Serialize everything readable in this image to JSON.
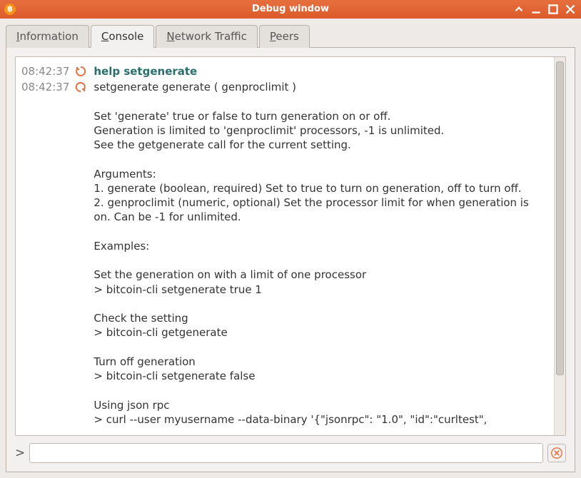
{
  "window": {
    "title": "Debug window",
    "app_icon_letter": "฿"
  },
  "tabs": [
    {
      "label_pre": "",
      "label_u": "I",
      "label_post": "nformation",
      "active": false
    },
    {
      "label_pre": "",
      "label_u": "C",
      "label_post": "onsole",
      "active": true
    },
    {
      "label_pre": "",
      "label_u": "N",
      "label_post": "etwork Traffic",
      "active": false
    },
    {
      "label_pre": "",
      "label_u": "P",
      "label_post": "eers",
      "active": false
    }
  ],
  "console": {
    "entries": [
      {
        "ts": "08:42:37",
        "icon": "cmd",
        "kind": "command",
        "text": "help setgenerate"
      },
      {
        "ts": "08:42:37",
        "icon": "reply",
        "kind": "output",
        "text": "setgenerate generate ( genproclimit )\n\nSet 'generate' true or false to turn generation on or off.\nGeneration is limited to 'genproclimit' processors, -1 is unlimited.\nSee the getgenerate call for the current setting.\n\nArguments:\n1. generate (boolean, required) Set to true to turn on generation, off to turn off.\n2. genproclimit (numeric, optional) Set the processor limit for when generation is on. Can be -1 for unlimited.\n\nExamples:\n\nSet the generation on with a limit of one processor\n> bitcoin-cli setgenerate true 1\n\nCheck the setting\n> bitcoin-cli getgenerate\n\nTurn off generation\n> bitcoin-cli setgenerate false\n\nUsing json rpc\n> curl --user myusername --data-binary '{\"jsonrpc\": \"1.0\", \"id\":\"curltest\","
      }
    ],
    "prompt": ">",
    "input_value": "",
    "input_placeholder": ""
  }
}
